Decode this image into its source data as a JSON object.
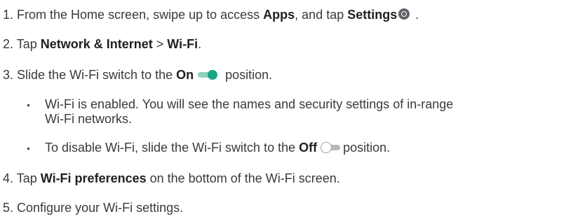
{
  "steps": [
    {
      "number": "1.",
      "text_a": "From the Home screen, swipe up to access ",
      "bold_a": "Apps",
      "text_b": ", and tap ",
      "bold_b": "Settings",
      "icon": "settings-gear-icon",
      "text_c": " ."
    },
    {
      "number": "2.",
      "text_a": "Tap ",
      "bold_a": "Network & Internet",
      "text_b": " > ",
      "bold_b": "Wi-Fi",
      "text_c": "."
    },
    {
      "number": "3.",
      "text_a": "Slide the Wi-Fi switch to the ",
      "bold_a": "On",
      "icon": "toggle-on-icon",
      "text_b": " position."
    },
    {
      "number": "4.",
      "text_a": "Tap ",
      "bold_a": "Wi-Fi preferences",
      "text_b": " on the bottom of the Wi-Fi screen."
    },
    {
      "number": "5.",
      "text_a": "Configure your Wi-Fi settings."
    }
  ],
  "bullets": [
    {
      "symbol": "•",
      "line1": "Wi-Fi is enabled. You will see the names and security settings of in-range",
      "line2": "Wi-Fi networks."
    },
    {
      "symbol": "•",
      "text_a": "To disable Wi-Fi, slide the Wi-Fi switch to the ",
      "bold_a": "Off",
      "icon": "toggle-off-icon",
      "text_b": "position."
    }
  ],
  "colors": {
    "toggle_on_knob": "#1aa589",
    "toggle_on_track": "#8fd0bf",
    "toggle_off_track": "#b8b8b8",
    "settings_icon": "#5f6368"
  }
}
